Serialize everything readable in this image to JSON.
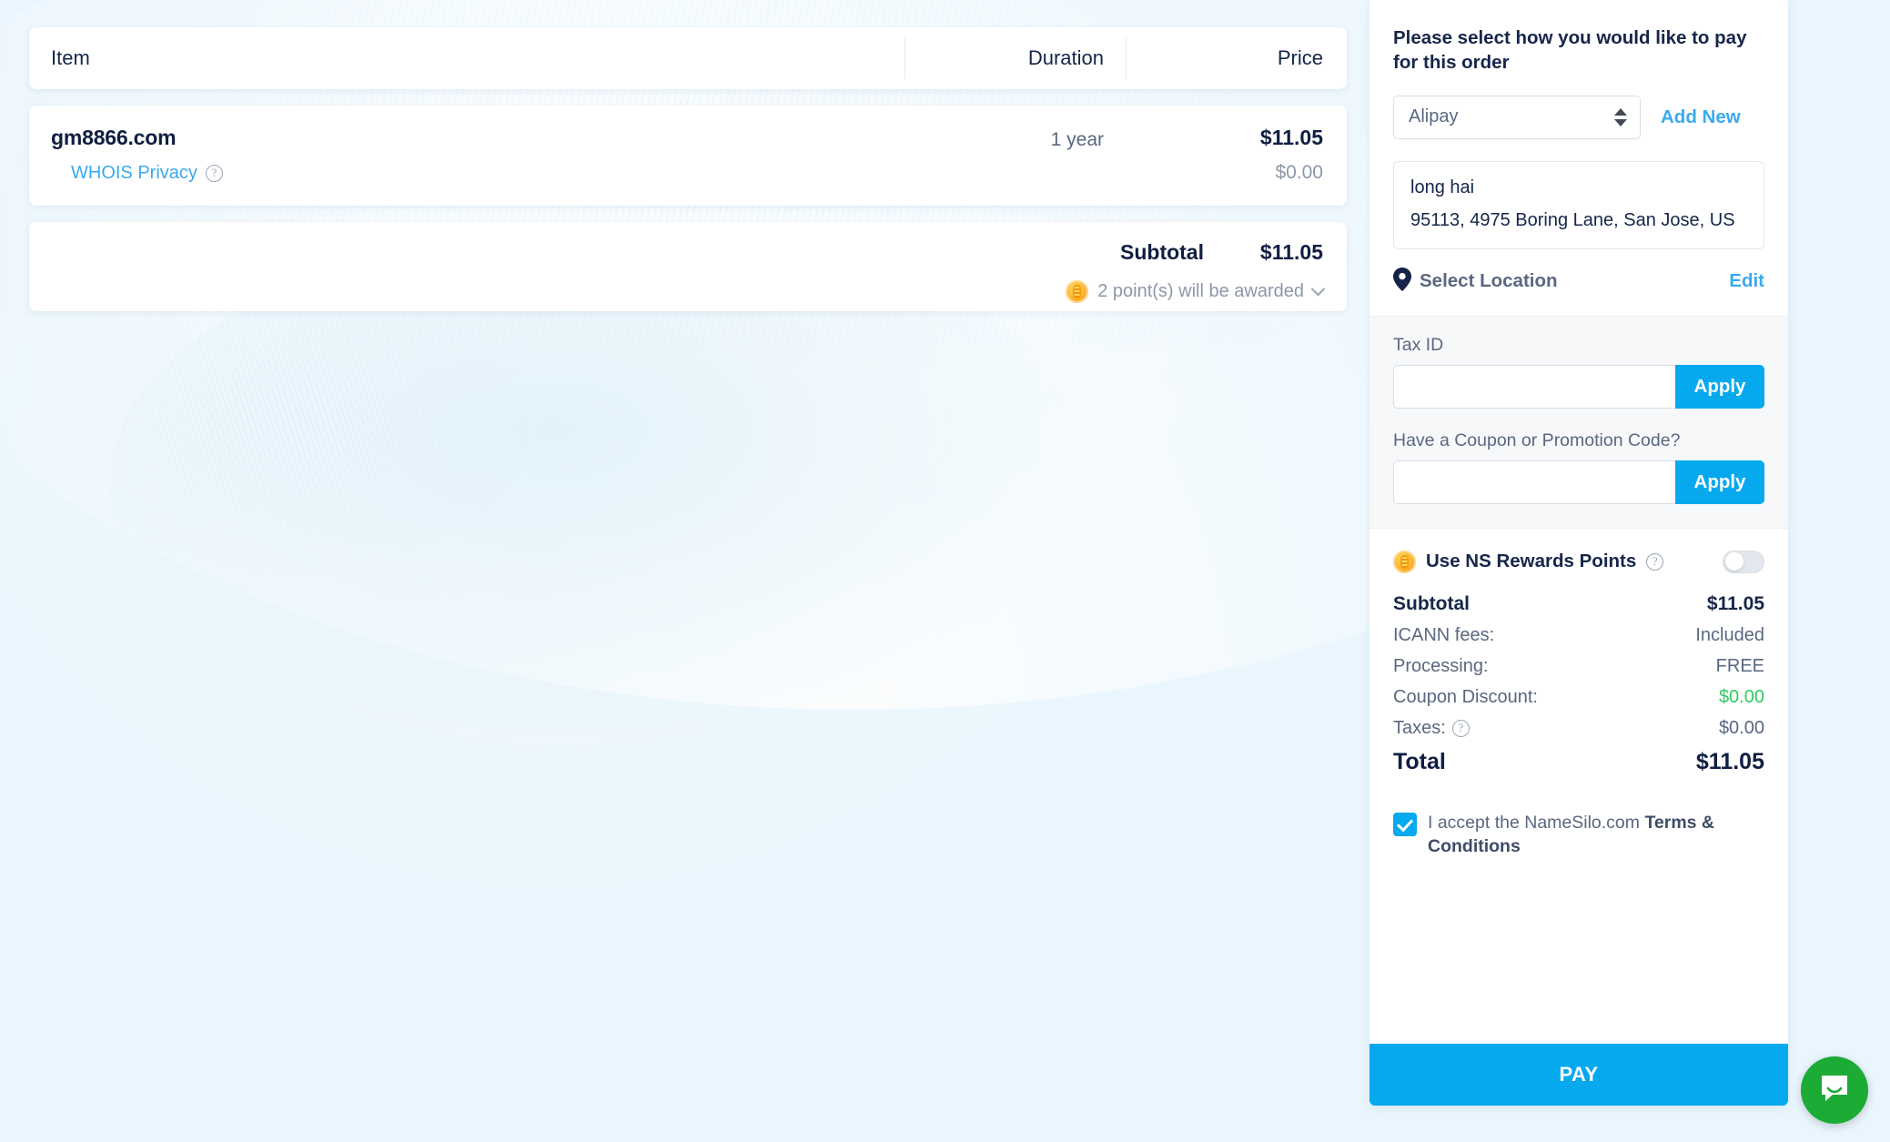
{
  "order_table": {
    "columns": {
      "item": "Item",
      "duration": "Duration",
      "price": "Price"
    },
    "rows": [
      {
        "name": "gm8866.com",
        "addon_label": "WHOIS Privacy",
        "addon_help_icon": "help-circle-icon",
        "duration": "1 year",
        "price": "$11.05",
        "addon_price": "$0.00"
      }
    ],
    "subtotal_label": "Subtotal",
    "subtotal_value": "$11.05",
    "points_icon": "rewards-coin-icon",
    "points_text": "2 point(s) will be awarded",
    "points_chevron_icon": "chevron-down-icon"
  },
  "payment_panel": {
    "heading": "Please select how you would like to pay for this order",
    "method": {
      "selected": "Alipay",
      "spinner_icon": "spinner-arrows-icon",
      "add_new_label": "Add New"
    },
    "address": {
      "name": "long hai",
      "line": "95113, 4975 Boring Lane, San Jose, US"
    },
    "location": {
      "pin_icon": "map-pin-icon",
      "label": "Select Location",
      "edit_label": "Edit"
    },
    "tax_id": {
      "label": "Tax ID",
      "value": "",
      "placeholder": "",
      "apply_label": "Apply"
    },
    "coupon": {
      "label": "Have a Coupon or Promotion Code?",
      "value": "",
      "placeholder": "",
      "apply_label": "Apply"
    },
    "rewards": {
      "coin_icon": "rewards-coin-icon",
      "label": "Use NS Rewards Points",
      "help_icon": "help-circle-icon",
      "toggle_state": "off"
    },
    "totals": [
      {
        "label": "Subtotal",
        "value": "$11.05",
        "emphasis": "strong",
        "value_color": ""
      },
      {
        "label": "ICANN fees:",
        "value": "Included",
        "emphasis": "",
        "value_color": ""
      },
      {
        "label": "Processing:",
        "value": "FREE",
        "emphasis": "",
        "value_color": ""
      },
      {
        "label": "Coupon Discount:",
        "value": "$0.00",
        "emphasis": "",
        "value_color": "#2fcc5f"
      },
      {
        "label": "Taxes:",
        "value": "$0.00",
        "emphasis": "",
        "value_color": "",
        "help_icon": "help-circle-icon"
      },
      {
        "label": "Total",
        "value": "$11.05",
        "emphasis": "grand",
        "value_color": ""
      }
    ],
    "terms": {
      "checked": true,
      "prefix": "I accept the NameSilo.com ",
      "link": "Terms & Conditions"
    },
    "pay_button_label": "PAY"
  },
  "chat": {
    "icon": "chat-bubble-icon",
    "color": "#1cab35"
  },
  "colors": {
    "accent_blue": "#06a9ee",
    "link_blue": "#3aaaef",
    "navy": "#16264a",
    "muted": "#5a6780",
    "green": "#2fcc5f",
    "page_bg": "#eaf6fd"
  }
}
